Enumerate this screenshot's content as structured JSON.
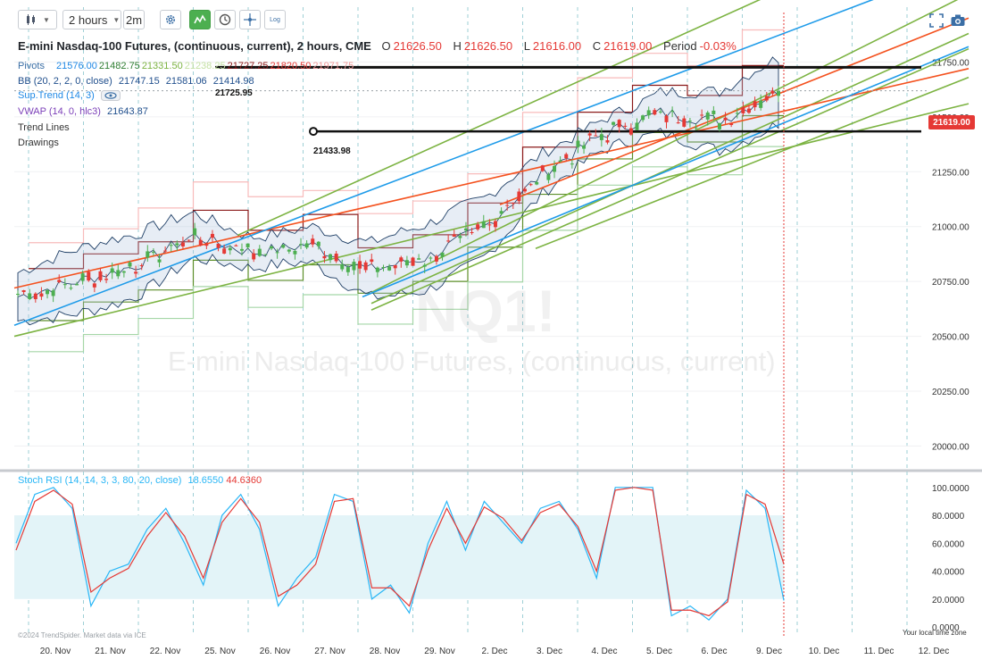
{
  "toolbar": {
    "chart_type_icon": "candlestick-icon",
    "timeframe_value": "2 hours",
    "timeframe_short": "2m",
    "settings_icon": "gear-icon",
    "indicator_icon": "line-chart-icon",
    "clock_icon": "clock-icon",
    "crosshair_icon": "crosshair-icon",
    "log_label": "Log",
    "fullscreen_icon": "fullscreen-icon",
    "camera_icon": "camera-icon"
  },
  "legend": {
    "title": "E-mini Nasdaq-100 Futures, (continuous, current), 2 hours, CME",
    "open_label": "O",
    "open": "21626.50",
    "high_label": "H",
    "high": "21626.50",
    "low_label": "L",
    "low": "21616.00",
    "close_label": "C",
    "close": "21619.00",
    "period_label": "Period",
    "period": "-0.03%",
    "pivots_label": "Pivots",
    "pivots_values": [
      {
        "text": "21576.00",
        "color": "#1e88e5"
      },
      {
        "text": "21482.75",
        "color": "#2e7d32"
      },
      {
        "text": "21331.50",
        "color": "#7cb342"
      },
      {
        "text": "21238.25",
        "color": "#c5e1a5"
      },
      {
        "text": "21727.25",
        "color": "#8b1a1a"
      },
      {
        "text": "21820.50",
        "color": "#e53935"
      },
      {
        "text": "21971.75",
        "color": "#ef9a9a"
      }
    ],
    "bb_label": "BB (20, 2, 2, 0, close)",
    "bb_values": [
      "21747.15",
      "21581.06",
      "21414.98"
    ],
    "supertrend_label": "Sup.Trend (14, 3)",
    "eye_icon": "eye-icon",
    "vwap_label": "VWAP (14, 0, hlc3)",
    "vwap_value": "21643.87",
    "trend_lines_label": "Trend Lines",
    "drawings_label": "Drawings"
  },
  "watermark": {
    "symbol": "NQ1!",
    "name": "E-mini Nasdaq-100 Futures, (continuous, current)"
  },
  "price_tag": "21619.00",
  "horizontal_levels": [
    {
      "label": "21725.95",
      "value": 21725.95
    },
    {
      "label": "21433.98",
      "value": 21433.98
    }
  ],
  "stoch_rsi": {
    "label": "Stoch RSI (14, 14, 3, 3, 80, 20, close)",
    "k_value": "18.6550",
    "d_value": "44.6360"
  },
  "copyright": "©2024 TrendSpider. Market data via ICE",
  "tz_note": "Your local time zone",
  "colors": {
    "up": "#4caf50",
    "down": "#e53935",
    "accent_blue": "#1e9be9",
    "trend_green": "#7cb342",
    "trend_red": "#f4511e"
  },
  "chart_data": [
    {
      "type": "candlestick",
      "x": [
        "20. Nov",
        "21. Nov",
        "22. Nov",
        "25. Nov",
        "26. Nov",
        "27. Nov",
        "28. Nov",
        "29. Nov",
        "2. Dec",
        "3. Dec",
        "4. Dec",
        "5. Dec",
        "6. Dec",
        "9. Dec",
        "10. Dec",
        "11. Dec",
        "12. Dec"
      ],
      "series": [
        {
          "name": "Price (approx. daily close)",
          "values": [
            20680,
            20750,
            20820,
            20960,
            20880,
            20920,
            20800,
            20860,
            21000,
            21250,
            21420,
            21520,
            21480,
            21619,
            null,
            null,
            null
          ]
        }
      ],
      "horizontal_levels": [
        21725.95,
        21433.98
      ],
      "y_ticks": [
        20000,
        20250,
        20500,
        20750,
        21000,
        21250,
        21500,
        21750
      ],
      "y_tick_labels": [
        "20000.00",
        "20250.00",
        "20500.00",
        "20750.00",
        "21000.00",
        "21250.00",
        "21500.00",
        "21750.00"
      ],
      "ylim": [
        19900,
        22000
      ],
      "grid": true
    },
    {
      "type": "line",
      "title": "Stoch RSI (14, 14, 3, 3, 80, 20, close)",
      "series": [
        {
          "name": "K",
          "color": "#29b6f6",
          "values": [
            60,
            95,
            100,
            85,
            15,
            40,
            45,
            70,
            85,
            60,
            30,
            80,
            95,
            70,
            15,
            35,
            50,
            95,
            90,
            20,
            30,
            10,
            60,
            90,
            55,
            90,
            75,
            60,
            85,
            90,
            70,
            35,
            100,
            100,
            100,
            8,
            15,
            5,
            20,
            98,
            85,
            19
          ]
        },
        {
          "name": "D",
          "color": "#e53935",
          "values": [
            55,
            90,
            98,
            88,
            25,
            35,
            42,
            65,
            82,
            65,
            35,
            75,
            92,
            75,
            22,
            30,
            45,
            90,
            92,
            28,
            28,
            15,
            55,
            85,
            60,
            86,
            78,
            62,
            82,
            88,
            72,
            40,
            98,
            100,
            98,
            12,
            12,
            8,
            18,
            95,
            88,
            45
          ]
        }
      ],
      "bands": [
        20,
        80
      ],
      "y_ticks": [
        0,
        20,
        40,
        60,
        80,
        100
      ],
      "y_tick_labels": [
        "0.0000",
        "20.0000",
        "40.0000",
        "60.0000",
        "80.0000",
        "100.0000"
      ],
      "ylim": [
        0,
        105
      ]
    }
  ]
}
